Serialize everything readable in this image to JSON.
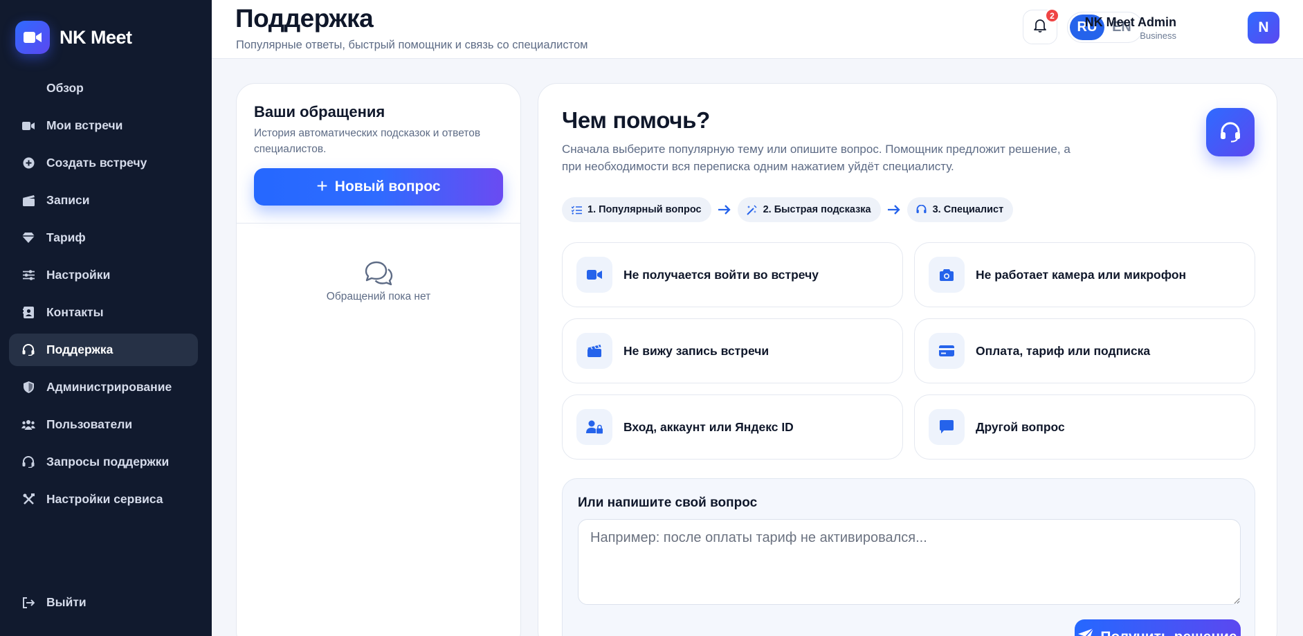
{
  "brand": {
    "name": "NK Meet"
  },
  "sidebar": {
    "items": [
      {
        "label": "Обзор",
        "icon": "none"
      },
      {
        "label": "Мои встречи",
        "icon": "video-icon"
      },
      {
        "label": "Создать встречу",
        "icon": "plus-circle-icon"
      },
      {
        "label": "Записи",
        "icon": "clapperboard-icon"
      },
      {
        "label": "Тариф",
        "icon": "gem-icon"
      },
      {
        "label": "Настройки",
        "icon": "sliders-icon"
      },
      {
        "label": "Контакты",
        "icon": "contacts-icon"
      },
      {
        "label": "Поддержка",
        "icon": "headset-icon",
        "active": true
      },
      {
        "label": "Администрирование",
        "icon": "shield-icon"
      },
      {
        "label": "Пользователи",
        "icon": "users-icon"
      },
      {
        "label": "Запросы поддержки",
        "icon": "headset-icon"
      },
      {
        "label": "Настройки сервиса",
        "icon": "tools-icon"
      }
    ],
    "logout_label": "Выйти"
  },
  "header": {
    "title": "Поддержка",
    "subtitle": "Популярные ответы, быстрый помощник и связь со специалистом",
    "notifications_count": "2",
    "lang_ru": "RU",
    "lang_en": "EN",
    "user_name": "NK Meet Admin",
    "user_plan": "Business",
    "avatar_initial": "N"
  },
  "requests": {
    "title": "Ваши обращения",
    "description": "История автоматических подсказок и ответов специалистов.",
    "new_button": "Новый вопрос",
    "empty_text": "Обращений пока нет"
  },
  "help": {
    "title": "Чем помочь?",
    "description": "Сначала выберите популярную тему или опишите вопрос. Помощник предложит решение, а при необходимости вся переписка одним нажатием уйдёт специалисту.",
    "steps": [
      {
        "label": "1. Популярный вопрос"
      },
      {
        "label": "2. Быстрая подсказка"
      },
      {
        "label": "3. Специалист"
      }
    ],
    "topics": [
      {
        "label": "Не получается войти во встречу",
        "icon": "video-icon"
      },
      {
        "label": "Не работает камера или микрофон",
        "icon": "camera-icon"
      },
      {
        "label": "Не вижу запись встречи",
        "icon": "clapperboard-icon"
      },
      {
        "label": "Оплата, тариф или подписка",
        "icon": "credit-card-icon"
      },
      {
        "label": "Вход, аккаунт или Яндекс ID",
        "icon": "user-lock-icon"
      },
      {
        "label": "Другой вопрос",
        "icon": "chat-bubble-icon"
      }
    ],
    "ask_title": "Или напишите свой вопрос",
    "ask_placeholder": "Например: после оплаты тариф не активировался...",
    "submit_label": "Получить решение"
  },
  "colors": {
    "accent": "#2563eb",
    "sidebar_bg": "#111a2e",
    "gradient_end": "#5b48f0"
  }
}
